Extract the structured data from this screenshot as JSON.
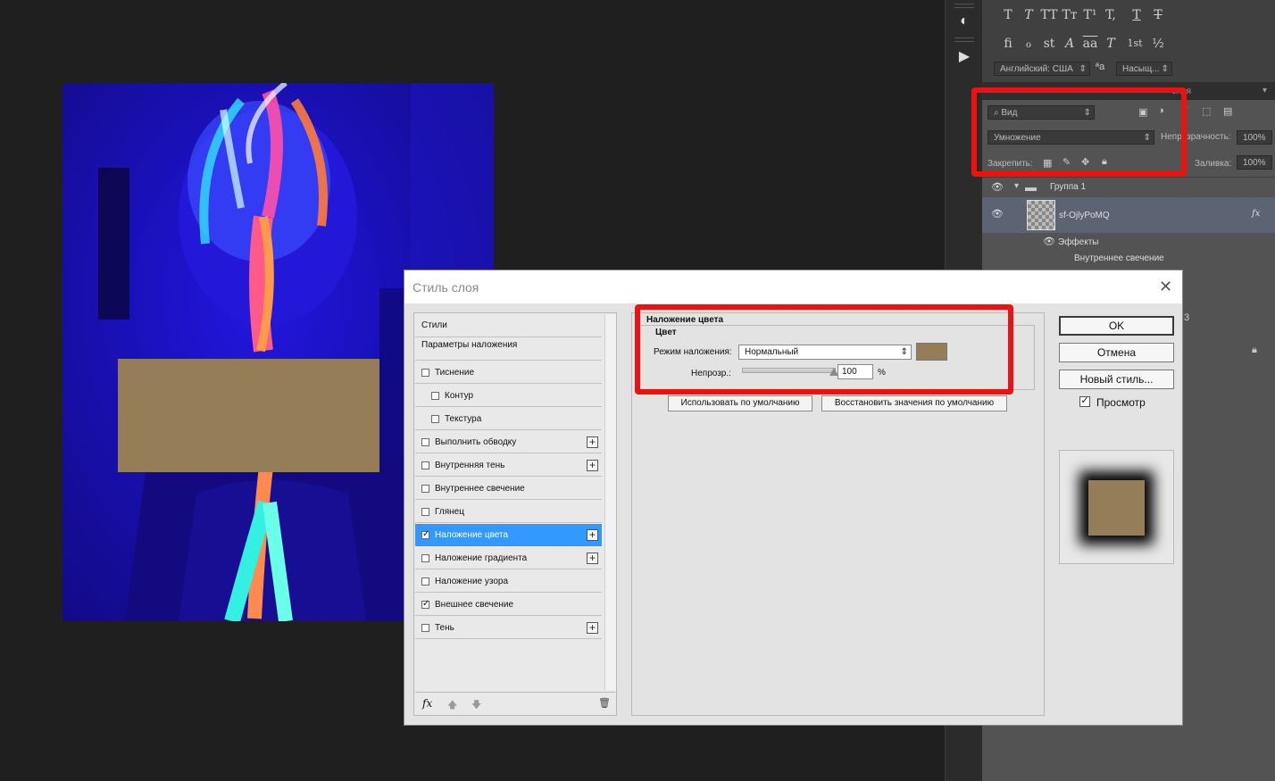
{
  "document": {
    "redaction_color": "#957e57"
  },
  "character_panel": {
    "row1_glyphs": [
      "T",
      "T",
      "TT",
      "Tт",
      "T¹",
      "T,",
      "T",
      "T"
    ],
    "row2_glyphs": [
      "fi",
      "ℴ",
      "st",
      "A",
      "aa",
      "T",
      "1st",
      "½"
    ],
    "language": "Английский: США",
    "aa_label": "ªa",
    "antialias": "Насыщ..."
  },
  "layers_panel": {
    "tab_label": "ения",
    "filter_label": "Вид",
    "blend_mode": "Умножение",
    "opacity_label": "Непрозрачность:",
    "opacity_value": "100%",
    "lock_label": "Закрепить:",
    "fill_label": "Заливка:",
    "fill_value": "100%",
    "group_name": "Группа 1",
    "layer_name": "sf-OjlyPoMQ",
    "fx_label": "fx",
    "effects_label": "Эффекты",
    "effect_inner_glow": "Внутреннее свечение",
    "partial_text": "3"
  },
  "dialog": {
    "title": "Стиль слоя",
    "styles_list": {
      "header_styles": "Стили",
      "header_blending": "Параметры наложения",
      "items": [
        {
          "label": "Тиснение",
          "checked": false,
          "plus": false,
          "indent": false
        },
        {
          "label": "Контур",
          "checked": false,
          "plus": false,
          "indent": true
        },
        {
          "label": "Текстура",
          "checked": false,
          "plus": false,
          "indent": true
        },
        {
          "label": "Выполнить обводку",
          "checked": false,
          "plus": true,
          "indent": false
        },
        {
          "label": "Внутренняя тень",
          "checked": false,
          "plus": true,
          "indent": false
        },
        {
          "label": "Внутреннее свечение",
          "checked": false,
          "plus": false,
          "indent": false
        },
        {
          "label": "Глянец",
          "checked": false,
          "plus": false,
          "indent": false
        },
        {
          "label": "Наложение цвета",
          "checked": true,
          "plus": true,
          "indent": false,
          "active": true
        },
        {
          "label": "Наложение градиента",
          "checked": false,
          "plus": true,
          "indent": false
        },
        {
          "label": "Наложение узора",
          "checked": false,
          "plus": false,
          "indent": false
        },
        {
          "label": "Внешнее свечение",
          "checked": true,
          "plus": false,
          "indent": false
        },
        {
          "label": "Тень",
          "checked": false,
          "plus": true,
          "indent": false
        }
      ],
      "footer_fx": "fx"
    },
    "section_title": "Наложение цвета",
    "group_title": "Цвет",
    "blend_mode_label": "Режим наложения:",
    "blend_mode_value": "Нормальный",
    "swatch_color": "#957e57",
    "opacity_label": "Непрозр.:",
    "opacity_value": "100",
    "opacity_unit": "%",
    "opacity_fraction": 1.0,
    "btn_use_default": "Использовать по умолчанию",
    "btn_restore_default": "Восстановить значения по умолчанию",
    "btn_ok": "OK",
    "btn_cancel": "Отмена",
    "btn_new_style": "Новый стиль...",
    "preview_label": "Просмотр",
    "preview_checked": true
  },
  "highlight_color": "#ee1111"
}
